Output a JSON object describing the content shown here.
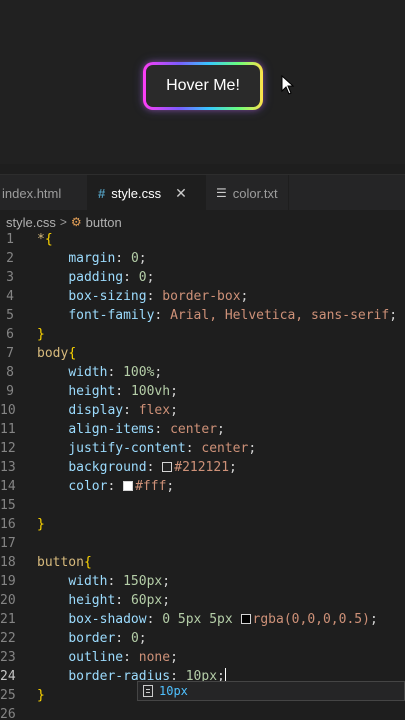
{
  "preview": {
    "button_label": "Hover Me!"
  },
  "tabs": [
    {
      "label": "index.html",
      "active": false
    },
    {
      "label": "style.css",
      "active": true
    },
    {
      "label": "color.txt",
      "active": false
    }
  ],
  "breadcrumb": {
    "file": "style.css",
    "symbol": "button"
  },
  "code": {
    "lines": [
      "1",
      "2",
      "3",
      "4",
      "5",
      "6",
      "7",
      "8",
      "9",
      "10",
      "11",
      "12",
      "13",
      "14",
      "15",
      "16",
      "17",
      "18",
      "19",
      "20",
      "21",
      "22",
      "23",
      "24",
      "25",
      "26"
    ],
    "l1_sel": "*",
    "l1_brace": "{",
    "l2_prop": "margin",
    "l2_val": "0",
    "l3_prop": "padding",
    "l3_val": "0",
    "l4_prop": "box-sizing",
    "l4_val": "border-box",
    "l5_prop": "font-family",
    "l5_val": "Arial, Helvetica, sans-serif",
    "l6": "}",
    "l7_sel": "body",
    "l7_brace": "{",
    "l8_prop": "width",
    "l8_val": "100%",
    "l9_prop": "height",
    "l9_val": "100vh",
    "l10_prop": "display",
    "l10_val": "flex",
    "l11_prop": "align-items",
    "l11_val": "center",
    "l12_prop": "justify-content",
    "l12_val": "center",
    "l13_prop": "background",
    "l13_val": "#212121",
    "l14_prop": "color",
    "l14_val": "#fff",
    "l16": "}",
    "l18_sel": "button",
    "l18_brace": "{",
    "l19_prop": "width",
    "l19_val": "150px",
    "l20_prop": "height",
    "l20_val": "60px",
    "l21_prop": "box-shadow",
    "l21_val": "0 5px 5px",
    "l21_color": "rgba(0,0,0,0.5)",
    "l22_prop": "border",
    "l22_val": "0",
    "l23_prop": "outline",
    "l23_val": "none",
    "l24_prop": "border-radius",
    "l24_val": "10px",
    "l25": "}"
  },
  "suggestion": {
    "text": "10px"
  },
  "colors": {
    "swatch_bg": "#212121",
    "swatch_fg": "#ffffff",
    "swatch_shadow": "#000000"
  }
}
